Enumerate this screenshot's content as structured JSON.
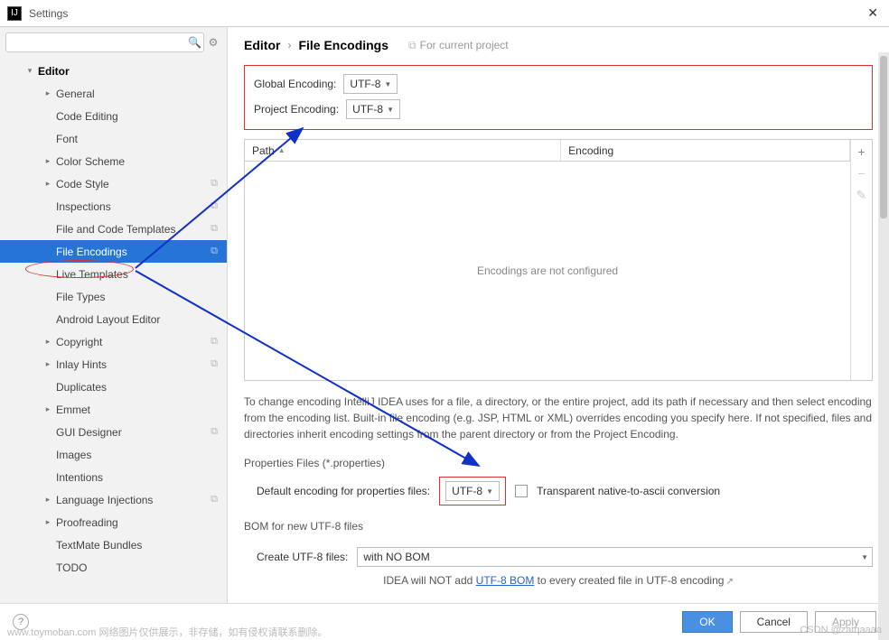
{
  "window": {
    "title": "Settings"
  },
  "search": {
    "placeholder": ""
  },
  "tree": {
    "editor": "Editor",
    "items": [
      {
        "label": "General",
        "chev": true,
        "copy": false
      },
      {
        "label": "Code Editing",
        "chev": false,
        "copy": false
      },
      {
        "label": "Font",
        "chev": false,
        "copy": false
      },
      {
        "label": "Color Scheme",
        "chev": true,
        "copy": false
      },
      {
        "label": "Code Style",
        "chev": true,
        "copy": true
      },
      {
        "label": "Inspections",
        "chev": false,
        "copy": true
      },
      {
        "label": "File and Code Templates",
        "chev": false,
        "copy": true
      },
      {
        "label": "File Encodings",
        "chev": false,
        "copy": true,
        "selected": true
      },
      {
        "label": "Live Templates",
        "chev": false,
        "copy": false
      },
      {
        "label": "File Types",
        "chev": false,
        "copy": false
      },
      {
        "label": "Android Layout Editor",
        "chev": false,
        "copy": false
      },
      {
        "label": "Copyright",
        "chev": true,
        "copy": true
      },
      {
        "label": "Inlay Hints",
        "chev": true,
        "copy": true
      },
      {
        "label": "Duplicates",
        "chev": false,
        "copy": false
      },
      {
        "label": "Emmet",
        "chev": true,
        "copy": false
      },
      {
        "label": "GUI Designer",
        "chev": false,
        "copy": true
      },
      {
        "label": "Images",
        "chev": false,
        "copy": false
      },
      {
        "label": "Intentions",
        "chev": false,
        "copy": false
      },
      {
        "label": "Language Injections",
        "chev": true,
        "copy": true
      },
      {
        "label": "Proofreading",
        "chev": true,
        "copy": false
      },
      {
        "label": "TextMate Bundles",
        "chev": false,
        "copy": false
      },
      {
        "label": "TODO",
        "chev": false,
        "copy": false
      }
    ]
  },
  "breadcrumb": {
    "a": "Editor",
    "b": "File Encodings",
    "scope": "For current project"
  },
  "form": {
    "global_label": "Global Encoding:",
    "global_value": "UTF-8",
    "project_label": "Project Encoding:",
    "project_value": "UTF-8"
  },
  "table": {
    "col_path": "Path",
    "col_enc": "Encoding",
    "empty": "Encodings are not configured"
  },
  "help_text": "To change encoding IntelliJ IDEA uses for a file, a directory, or the entire project, add its path if necessary and then select encoding from the encoding list. Built-in file encoding (e.g. JSP, HTML or XML) overrides encoding you specify here. If not specified, files and directories inherit encoding settings from the parent directory or from the Project Encoding.",
  "props": {
    "section": "Properties Files (*.properties)",
    "label": "Default encoding for properties files:",
    "value": "UTF-8",
    "checkbox_label": "Transparent native-to-ascii conversion"
  },
  "bom": {
    "section": "BOM for new UTF-8 files",
    "label": "Create UTF-8 files:",
    "value": "with NO BOM",
    "note_a": "IDEA will NOT add ",
    "note_link": "UTF-8 BOM",
    "note_b": " to every created file in UTF-8 encoding"
  },
  "footer": {
    "ok": "OK",
    "cancel": "Cancel",
    "apply": "Apply"
  },
  "watermark": {
    "left": "www.toymoban.com 网络图片仅供展示，非存储，如有侵权请联系删除。",
    "right": "CSDN @zatqaaaa"
  }
}
